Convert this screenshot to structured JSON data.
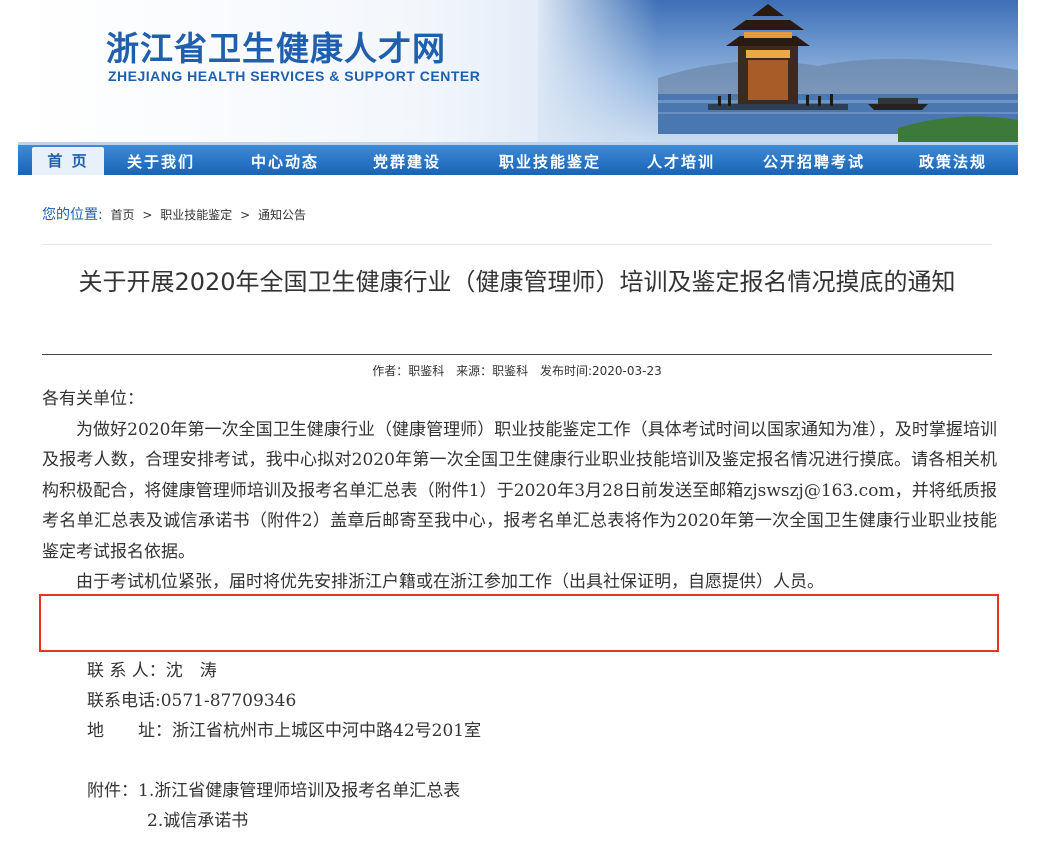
{
  "header": {
    "logo_cn": "浙江省卫生健康人才网",
    "logo_en": "ZHEJIANG HEALTH SERVICES & SUPPORT CENTER"
  },
  "nav": [
    {
      "label": "首 页",
      "active": true
    },
    {
      "label": "关于我们"
    },
    {
      "label": "中心动态"
    },
    {
      "label": "党群建设"
    },
    {
      "label": "职业技能鉴定"
    },
    {
      "label": "人才培训"
    },
    {
      "label": "公开招聘考试"
    },
    {
      "label": "政策法规"
    }
  ],
  "breadcrumb": {
    "label": "您的位置:",
    "items": [
      "首页",
      ">",
      "职业技能鉴定",
      ">",
      "通知公告"
    ]
  },
  "article": {
    "title": "关于开展2020年全国卫生健康行业（健康管理师）培训及鉴定报名情况摸底的通知",
    "author": "作者：职鉴科",
    "source": "来源：职鉴科",
    "date": "发布时间:2020-03-23",
    "salutation": "各有关单位：",
    "para1": "为做好2020年第一次全国卫生健康行业（健康管理师）职业技能鉴定工作（具体考试时间以国家通知为准），及时掌握培训及报考人数，合理安排考试，我中心拟对2020年第一次全国卫生健康行业职业技能培训及鉴定报名情况进行摸底。请各相关机构积极配合，将健康管理师培训及报考名单汇总表（附件1）于2020年3月28日前发送至邮箱zjswszj@163.com，并将纸质报考名单汇总表及诚信承诺书（附件2）盖章后邮寄至我中心，报考名单汇总表将作为2020年第一次全国卫生健康行业职业技能鉴定考试报名依据。",
    "para2": "由于考试机位紧张，届时将优先安排浙江户籍或在浙江参加工作（出具社保证明，自愿提供）人员。",
    "contact_person": "联 系 人：沈　涛",
    "contact_phone": "联系电话:0571-87709346",
    "address": "地　　址：浙江省杭州市上城区中河中路42号201室",
    "attachment1": "附件：1.浙江省健康管理师培训及报考名单汇总表",
    "attachment2": "2.诚信承诺书"
  },
  "colors": {
    "brand": "#1f5fae",
    "nav": "#1863b6",
    "highlight": "#e63324"
  }
}
